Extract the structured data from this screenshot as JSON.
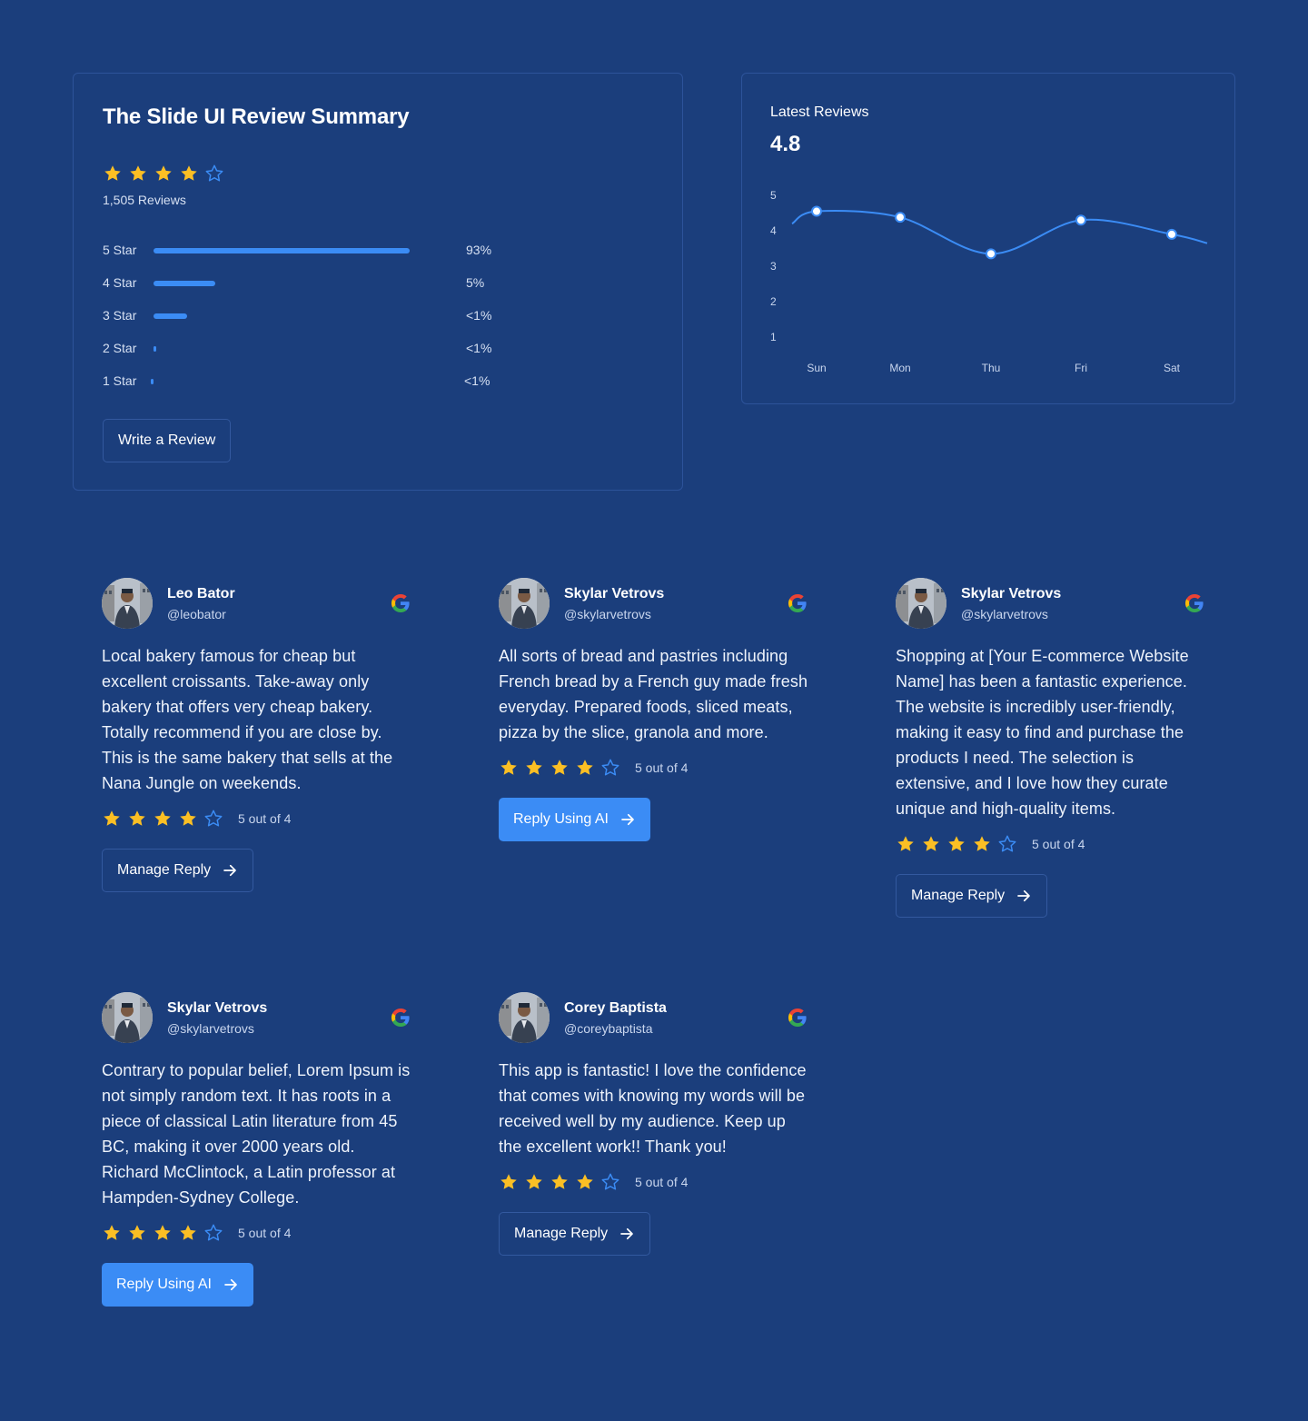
{
  "summary": {
    "title": "The Slide UI Review Summary",
    "rating_stars": 4,
    "review_count": "1,505 Reviews",
    "distribution": [
      {
        "label": "5 Star",
        "percent_text": "93%",
        "fill": 1.0
      },
      {
        "label": "4 Star",
        "percent_text": "5%",
        "fill": 0.24
      },
      {
        "label": "3 Star",
        "percent_text": "<1%",
        "fill": 0.13
      },
      {
        "label": "2 Star",
        "percent_text": "<1%",
        "fill": 0.01
      },
      {
        "label": "1 Star",
        "percent_text": "<1%",
        "fill": 0.01
      }
    ],
    "write_button": "Write a Review"
  },
  "latest": {
    "title": "Latest Reviews",
    "value": "4.8"
  },
  "chart_data": {
    "type": "line",
    "title": "Latest Reviews",
    "categories": [
      "Sun",
      "Mon",
      "Thu",
      "Fri",
      "Sat"
    ],
    "series": [
      {
        "values": [
          4.55,
          4.38,
          3.35,
          4.3,
          3.9
        ]
      }
    ],
    "yticks": [
      1,
      2,
      3,
      4,
      5
    ],
    "ylim": [
      1,
      5
    ],
    "grid": false,
    "line_color": "#3b8cf5"
  },
  "colors": {
    "background": "#1b3e7c",
    "accent": "#3b8cf5",
    "star": "#fbbf24",
    "border": "#2d539a"
  },
  "reviews": [
    {
      "name": "Leo Bator",
      "handle": "@leobator",
      "text": "Local bakery famous for cheap but excellent croissants. Take-away only bakery that offers very cheap bakery. Totally recommend if you are close by. This is the same bakery that sells at the Nana Jungle on weekends.",
      "stars": 4,
      "score": "5 out of 4",
      "button": "Manage Reply",
      "button_style": "outline"
    },
    {
      "name": "Skylar Vetrovs",
      "handle": "@skylarvetrovs",
      "text": "All sorts of bread and pastries including French bread by a French guy made fresh everyday. Prepared foods, sliced meats, pizza by the slice, granola and more.",
      "stars": 4,
      "score": "5 out of 4",
      "button": "Reply Using AI",
      "button_style": "solid"
    },
    {
      "name": "Skylar Vetrovs",
      "handle": "@skylarvetrovs",
      "text": "Shopping at [Your E-commerce Website Name] has been a fantastic experience. The website is incredibly user-friendly, making it easy to find and purchase the products I need. The selection is extensive, and I love how they curate unique and high-quality items.",
      "stars": 4,
      "score": "5 out of 4",
      "button": "Manage Reply",
      "button_style": "outline"
    },
    {
      "name": "Skylar Vetrovs",
      "handle": "@skylarvetrovs",
      "text": "Contrary to popular belief, Lorem Ipsum is not simply random text. It has roots in a piece of classical Latin literature from 45 BC, making it over 2000 years old. Richard McClintock, a Latin professor at Hampden-Sydney College.",
      "stars": 4,
      "score": "5 out of 4",
      "button": "Reply Using AI",
      "button_style": "solid"
    },
    {
      "name": "Corey Baptista",
      "handle": "@coreybaptista",
      "text": "This app is fantastic! I love the confidence that comes with knowing my words will be received well by my audience. Keep up the excellent work!! Thank you!",
      "stars": 4,
      "score": "5 out of 4",
      "button": "Manage Reply",
      "button_style": "outline"
    }
  ]
}
